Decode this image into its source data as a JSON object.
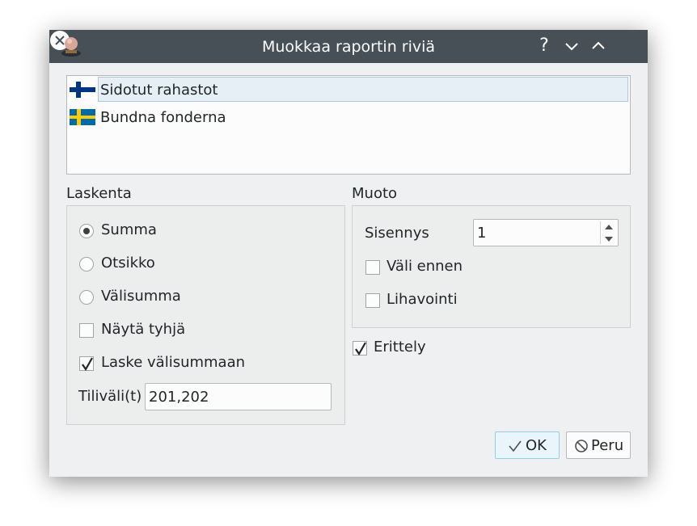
{
  "window": {
    "title": "Muokkaa raportin riviä",
    "help_glyph": "?"
  },
  "languages": [
    {
      "label": "Sidotut rahastot",
      "flag": "finland-flag",
      "selected": true
    },
    {
      "label": "Bundna fonderna",
      "flag": "sweden-flag",
      "selected": false
    }
  ],
  "laskenta": {
    "title": "Laskenta",
    "summa": "Summa",
    "otsikko": "Otsikko",
    "valisumma": "Välisumma",
    "nayta_tyhja": "Näytä tyhjä",
    "laske_valisummaan": "Laske välisummaan",
    "tilivali_label": "Tiliväli(t)",
    "tilivali_value": "201,202",
    "selected_mode": "Summa"
  },
  "muoto": {
    "title": "Muoto",
    "sisennys_label": "Sisennys",
    "sisennys_value": "1",
    "vali_ennen": "Väli ennen",
    "lihavointi": "Lihavointi"
  },
  "erittely": "Erittely",
  "buttons": {
    "ok": "OK",
    "cancel": "Peru"
  },
  "colors": {
    "titlebar": "#475057",
    "selection": "#e6eef6",
    "default_button": "#eaf5fb",
    "window_bg": "#eff0f1"
  }
}
